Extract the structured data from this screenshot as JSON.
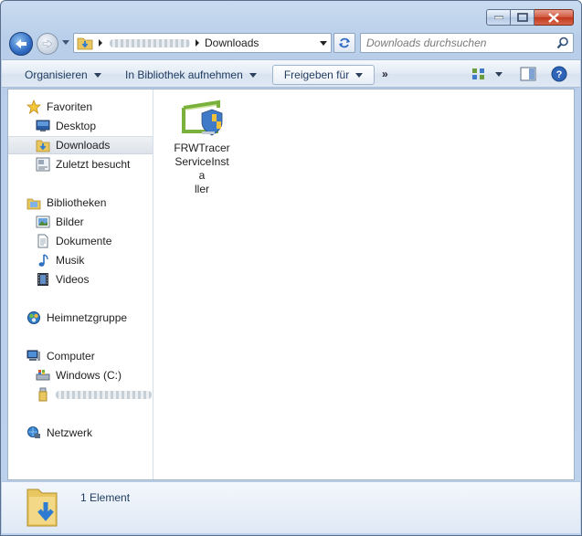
{
  "window": {
    "title": "Downloads"
  },
  "address": {
    "path_current": "Downloads",
    "user_segment_blurred": ""
  },
  "search": {
    "placeholder": "Downloads durchsuchen"
  },
  "toolbar": {
    "organize": "Organisieren",
    "library": "In Bibliothek aufnehmen",
    "share": "Freigeben für",
    "more": "»"
  },
  "sidebar": {
    "favorites": {
      "label": "Favoriten",
      "items": [
        "Desktop",
        "Downloads",
        "Zuletzt besucht"
      ]
    },
    "libraries": {
      "label": "Bibliotheken",
      "items": [
        "Bilder",
        "Dokumente",
        "Musik",
        "Videos"
      ]
    },
    "homegroup": {
      "label": "Heimnetzgruppe"
    },
    "computer": {
      "label": "Computer",
      "items": [
        "Windows (C:)"
      ]
    },
    "network": {
      "label": "Netzwerk"
    }
  },
  "files": [
    {
      "name": "FRWTracer ServiceInstaller",
      "line1": "FRWTracer",
      "line2": "ServiceInsta",
      "line3": "ller",
      "icon": "installer-shield-icon"
    }
  ],
  "details": {
    "count": "1 Element"
  },
  "colors": {
    "accent": "#2f6bc3",
    "close": "#c1371b",
    "selection": "#dde3ea"
  }
}
